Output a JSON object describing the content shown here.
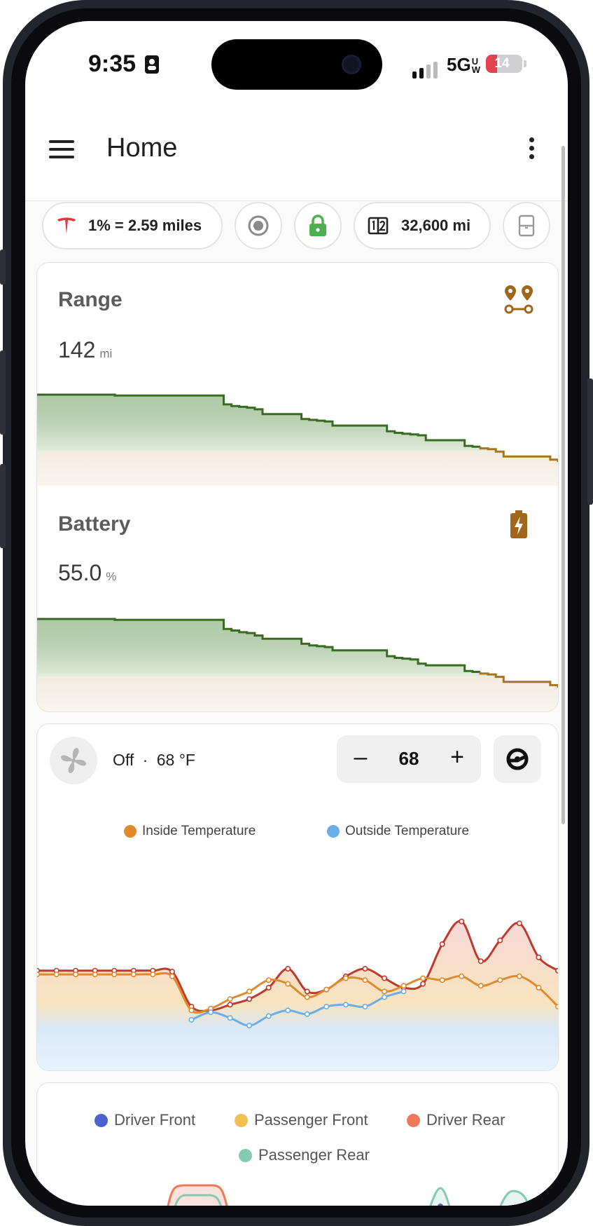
{
  "status_bar": {
    "time": "9:35",
    "network": "5G",
    "network_badge": "UW",
    "battery_level": "14",
    "battery_color": "#e2434c"
  },
  "app_bar": {
    "title": "Home",
    "menu_icon": "hamburger-menu-icon",
    "overflow_icon": "more-vert-icon"
  },
  "chips": {
    "efficiency": "1% = 2.59 miles",
    "efficiency_icon": "tesla-logo-icon",
    "sentry_icon": "record-circle-icon",
    "lock_icon": "lock-icon",
    "lock_color": "#4caf50",
    "odometer": "32,600 mi",
    "odometer_icon": "odometer-icon",
    "trunk_icon": "vehicle-door-icon"
  },
  "range": {
    "title": "Range",
    "value": "142",
    "unit": "mi",
    "icon": "map-marker-distance-icon",
    "icon_color": "#a0661a"
  },
  "battery": {
    "title": "Battery",
    "value": "55.0",
    "unit": "%",
    "icon": "battery-charging-icon",
    "icon_color": "#a0661a"
  },
  "climate": {
    "status": "Off",
    "separator": "·",
    "set_temp": "68 °F",
    "target_value": "68",
    "minus_label": "–",
    "plus_label": "+",
    "fan_icon": "fan-icon",
    "defrost_icon": "steering-wheel-heat-icon"
  },
  "temperature_chart": {
    "legend": [
      {
        "label": "Inside Temperature",
        "color": "#e08a2e"
      },
      {
        "label": "Outside Temperature",
        "color": "#6aaee8"
      }
    ]
  },
  "seat_heater_chart": {
    "legend": [
      {
        "label": "Driver Front",
        "color": "#4a63d1"
      },
      {
        "label": "Passenger Front",
        "color": "#f1c04f"
      },
      {
        "label": "Driver Rear",
        "color": "#ee7a5a"
      },
      {
        "label": "Passenger Rear",
        "color": "#84cbb0"
      }
    ]
  },
  "chart_data": [
    {
      "type": "area",
      "name": "range-sparkline",
      "y": [
        100,
        100,
        100,
        100,
        100,
        100,
        100,
        100,
        100,
        100,
        99,
        99,
        99,
        99,
        99,
        99,
        99,
        99,
        99,
        99,
        99,
        99,
        99,
        99,
        88,
        86,
        85,
        84,
        82,
        76,
        76,
        76,
        76,
        76,
        70,
        69,
        68,
        67,
        62,
        62,
        62,
        62,
        62,
        62,
        62,
        55,
        53,
        52,
        51,
        50,
        44,
        44,
        44,
        44,
        44,
        37,
        36,
        34,
        33,
        30,
        24,
        24,
        24,
        24,
        24,
        24,
        20,
        17
      ],
      "ylim": [
        0,
        100
      ]
    },
    {
      "type": "area",
      "name": "battery-sparkline",
      "y": [
        100,
        100,
        100,
        100,
        100,
        100,
        100,
        100,
        100,
        100,
        99,
        99,
        99,
        99,
        99,
        99,
        99,
        99,
        99,
        99,
        99,
        99,
        99,
        99,
        88,
        86,
        84,
        83,
        80,
        76,
        76,
        76,
        76,
        76,
        70,
        68,
        67,
        66,
        62,
        62,
        62,
        62,
        62,
        62,
        62,
        55,
        53,
        52,
        51,
        46,
        44,
        44,
        44,
        44,
        44,
        37,
        36,
        34,
        33,
        30,
        24,
        24,
        24,
        24,
        24,
        24,
        20,
        17
      ],
      "ylim": [
        0,
        100
      ]
    },
    {
      "type": "line",
      "name": "cabin-temperature",
      "x": [
        0,
        1,
        2,
        3,
        4,
        5,
        6,
        7,
        8,
        9,
        10,
        11,
        12,
        13,
        14,
        15,
        16,
        17,
        18,
        19,
        20,
        21,
        22,
        23,
        24,
        25,
        26,
        27
      ],
      "series": [
        {
          "name": "Inside Temperature",
          "color": "#c0392b",
          "y": [
            58,
            58,
            58,
            58,
            58,
            58,
            58,
            57,
            20,
            16,
            22,
            28,
            40,
            60,
            36,
            38,
            52,
            60,
            50,
            40,
            44,
            86,
            110,
            68,
            90,
            108,
            72,
            58
          ]
        },
        {
          "name": "Outside Temperature",
          "color": "#e08a2e",
          "y": [
            54,
            54,
            54,
            54,
            54,
            54,
            54,
            52,
            16,
            18,
            28,
            36,
            48,
            44,
            30,
            38,
            50,
            48,
            36,
            42,
            50,
            48,
            52,
            42,
            48,
            52,
            40,
            20
          ]
        },
        {
          "name": "Outside Temperature",
          "color": "#6aaee8",
          "y": [
            null,
            null,
            null,
            null,
            null,
            null,
            null,
            null,
            6,
            14,
            8,
            0,
            10,
            16,
            12,
            20,
            22,
            20,
            30,
            36,
            null,
            null,
            null,
            null,
            null,
            null,
            null,
            null
          ]
        }
      ]
    }
  ]
}
